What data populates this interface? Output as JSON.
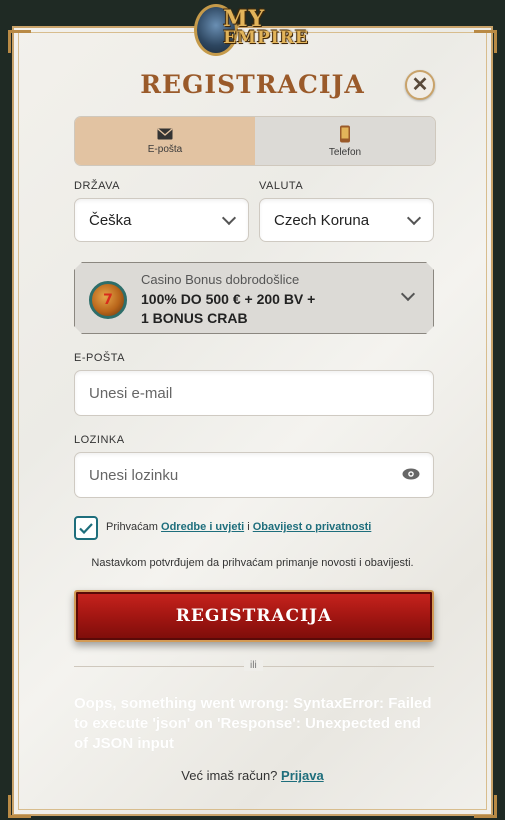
{
  "logo": {
    "line1": "MY",
    "line2": "EMPIRE"
  },
  "title": "REGISTRACIJA",
  "close_symbol": "✕",
  "tabs": [
    {
      "label": "E-pošta",
      "icon": "envelope-icon",
      "active": true
    },
    {
      "label": "Telefon",
      "icon": "phone-icon",
      "active": false
    }
  ],
  "country": {
    "label": "DRŽAVA",
    "value": "Češka"
  },
  "currency": {
    "label": "VALUTA",
    "value": "Czech Koruna"
  },
  "bonus": {
    "subtitle": "Casino Bonus dobrodošlice",
    "line1": "100% DO 500 € + 200 BV +",
    "line2": "1 BONUS CRAB",
    "icon": "slot-machine-icon"
  },
  "email": {
    "label": "E-POŠTA",
    "placeholder": "Unesi e-mail"
  },
  "password": {
    "label": "LOZINKA",
    "placeholder": "Unesi lozinku"
  },
  "consent": {
    "checked": true,
    "prefix": "Prihvaćam",
    "link1": "Odredbe i uvjeti",
    "sep": "i",
    "link2": "Obavijest o privatnosti"
  },
  "note": "Nastavkom potvrđujem da prihvaćam primanje novosti i obavijesti.",
  "register_button": "REGISTRACIJA",
  "or": "ili",
  "error": "Oops, something went wrong: SyntaxError: Failed to execute 'json' on 'Response': Unexpected end of JSON input",
  "login": {
    "prompt": "Već imaš račun?",
    "link": "Prijava"
  },
  "colors": {
    "accent": "#1e6e7c",
    "title": "#9a5a2a",
    "button": "#a31612",
    "tab_active": "#e2c3a2"
  }
}
